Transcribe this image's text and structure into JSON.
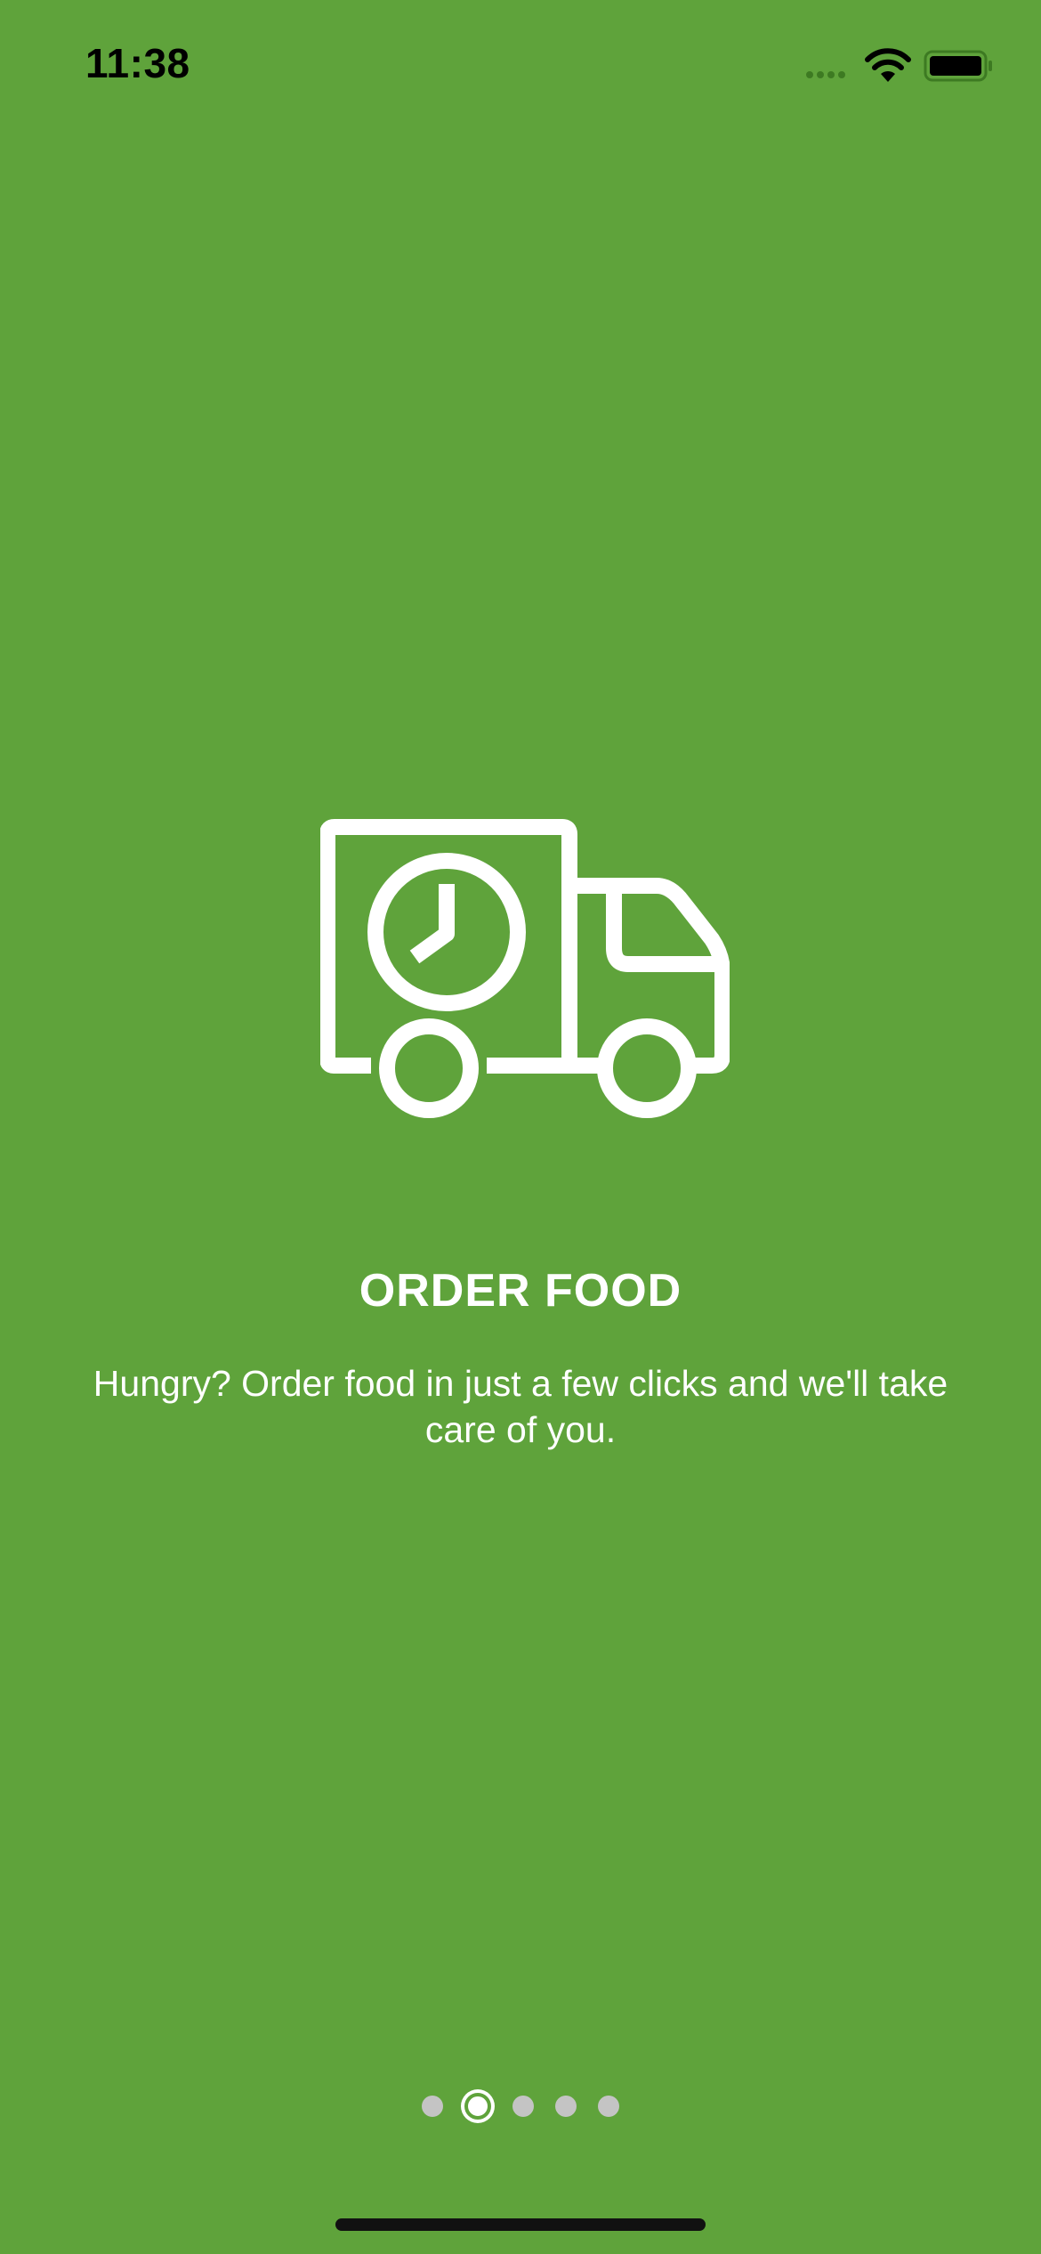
{
  "status_bar": {
    "time": "11:38"
  },
  "onboarding": {
    "title": "ORDER FOOD",
    "description": "Hungry? Order food in just a few clicks and we'll take care of you.",
    "illustration_icon": "delivery-truck-clock-icon"
  },
  "page_indicator": {
    "total_pages": 5,
    "current_page": 2
  },
  "colors": {
    "background": "#5fa33b",
    "foreground": "#ffffff",
    "inactive_dot": "#c4c4c4"
  }
}
